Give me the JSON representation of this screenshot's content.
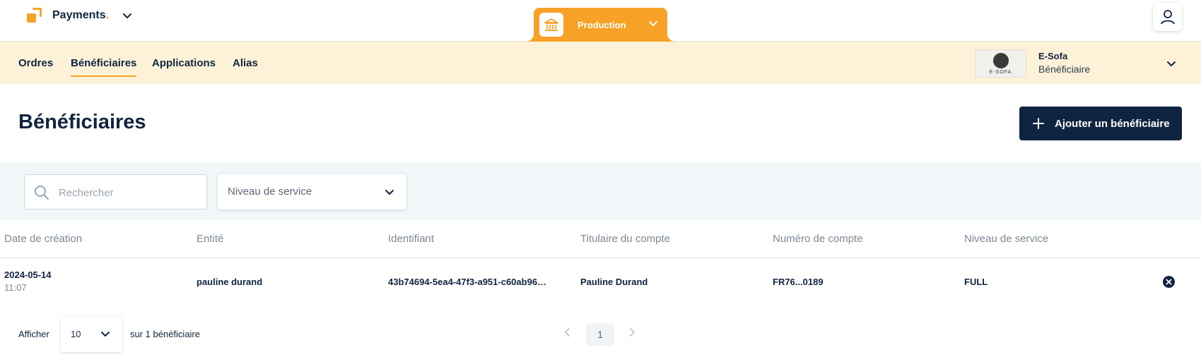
{
  "header": {
    "brand": "Payments",
    "brand_dot": ".",
    "environment": "Production"
  },
  "nav": {
    "items": [
      {
        "label": "Ordres",
        "active": false
      },
      {
        "label": "Bénéficiaires",
        "active": true
      },
      {
        "label": "Applications",
        "active": false
      },
      {
        "label": "Alias",
        "active": false
      }
    ]
  },
  "entity": {
    "logo_text": "E-SOFA",
    "name": "E-Sofa",
    "role": "Bénéficiaire"
  },
  "page": {
    "title": "Bénéficiaires",
    "add_button": "Ajouter un bénéficiaire"
  },
  "filters": {
    "search_placeholder": "Rechercher",
    "service_level": "Niveau de service"
  },
  "table": {
    "columns": [
      "Date de création",
      "Entité",
      "Identifiant",
      "Titulaire du compte",
      "Numéro de compte",
      "Niveau de service"
    ],
    "rows": [
      {
        "date": "2024-05-14",
        "time": "11:07",
        "entity": "pauline durand",
        "id": "43b74694-5ea4-47f3-a951-c60ab96…",
        "holder": "Pauline Durand",
        "account": "FR76...0189",
        "level": "FULL"
      }
    ]
  },
  "pagination": {
    "show_label": "Afficher",
    "per_page": "10",
    "total": "sur 1 bénéficiaire",
    "current_page": "1"
  },
  "colors": {
    "accent": "#f7a226",
    "navy": "#0f2440",
    "nav_bg": "#fdf2d7",
    "filter_bg": "#f1f6f8"
  }
}
